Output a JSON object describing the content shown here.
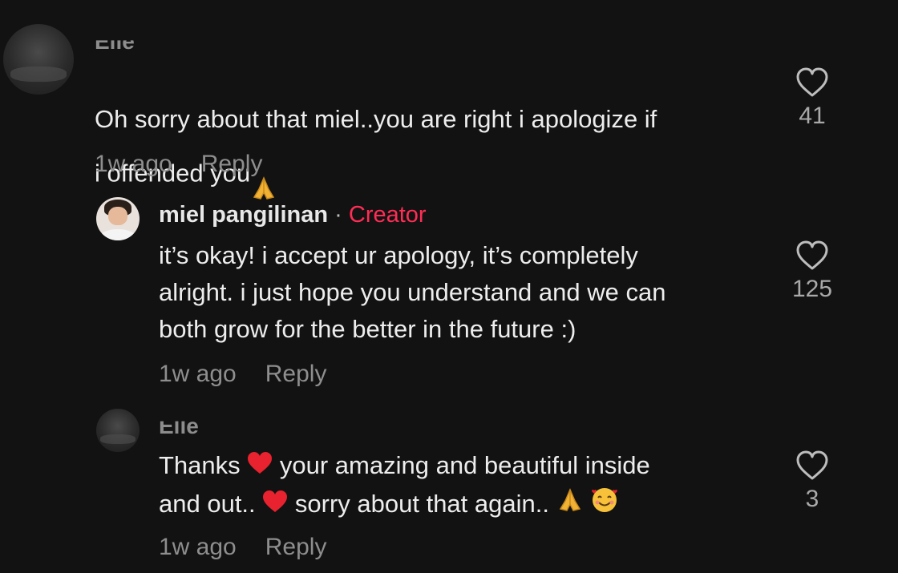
{
  "comments": [
    {
      "username": "Elle",
      "text_prefix": "Oh sorry about that miel..you are right i apologize if\ni offended you",
      "time": "1w ago",
      "reply_label": "Reply",
      "likes": "41"
    },
    {
      "username": "miel pangilinan",
      "separator": " · ",
      "badge": "Creator",
      "text": "it’s okay! i accept ur apology, it’s completely\nalright. i just hope you understand and we can\nboth grow for the better in the future :)",
      "time": "1w ago",
      "reply_label": "Reply",
      "likes": "125"
    },
    {
      "username": "Elle",
      "text_line1_a": "Thanks ",
      "text_line1_b": " your amazing and beautiful inside",
      "text_line2_a": "and out.. ",
      "text_line2_b": " sorry about that again.. ",
      "time": "1w ago",
      "reply_label": "Reply",
      "likes": "3"
    }
  ],
  "icons": {
    "like": "heart-outline-icon",
    "emoji_pray": "folded-hands-emoji",
    "emoji_heart": "red-heart-emoji",
    "emoji_smile_hearts": "smiling-face-with-hearts-emoji"
  },
  "colors": {
    "background": "#121212",
    "creator_badge": "#ff2d55",
    "meta_text": "#8e8e8e"
  }
}
